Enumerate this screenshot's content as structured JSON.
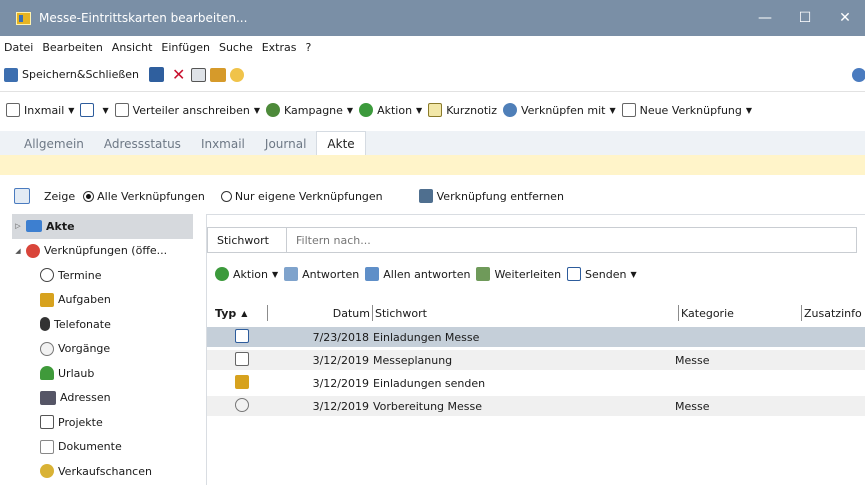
{
  "window": {
    "title": "Messe-Eintrittskarten bearbeiten...",
    "minimize": "—",
    "maximize": "☐",
    "close": "✕"
  },
  "menu": [
    "Datei",
    "Bearbeiten",
    "Ansicht",
    "Einfügen",
    "Suche",
    "Extras",
    "?"
  ],
  "toolbar1": {
    "save_close": "Speichern&Schließen"
  },
  "toolbar2": {
    "inxmail": "Inxmail",
    "verteiler": "Verteiler anschreiben",
    "kampagne": "Kampagne",
    "aktion": "Aktion",
    "kurznotiz": "Kurznotiz",
    "verknuepfen": "Verknüpfen mit",
    "neue_verknuepfung": "Neue Verknüpfung"
  },
  "tabs": [
    "Allgemein",
    "Adressstatus",
    "Inxmail",
    "Journal",
    "Akte"
  ],
  "filter": {
    "zeige": "Zeige",
    "alle": "Alle Verknüpfungen",
    "eigene": "Nur eigene Verknüpfungen",
    "entfernen": "Verknüpfung entfernen"
  },
  "sidebar": {
    "akte": "Akte",
    "verknuepfungen": "Verknüpfungen (öffe...",
    "items": [
      "Termine",
      "Aufgaben",
      "Telefonate",
      "Vorgänge",
      "Urlaub",
      "Adressen",
      "Projekte",
      "Dokumente",
      "Verkaufschancen"
    ]
  },
  "search": {
    "label": "Stichwort",
    "placeholder": "Filtern nach..."
  },
  "actions": {
    "aktion": "Aktion",
    "antworten": "Antworten",
    "allen": "Allen antworten",
    "weiterleiten": "Weiterleiten",
    "senden": "Senden"
  },
  "columns": {
    "typ": "Typ",
    "datum": "Datum",
    "stichwort": "Stichwort",
    "kategorie": "Kategorie",
    "zusatz": "Zusatzinfo"
  },
  "rows": [
    {
      "datum": "7/23/2018",
      "stichwort": "Einladungen Messe",
      "kategorie": ""
    },
    {
      "datum": "3/12/2019",
      "stichwort": "Messeplanung",
      "kategorie": "Messe"
    },
    {
      "datum": "3/12/2019",
      "stichwort": "Einladungen senden",
      "kategorie": ""
    },
    {
      "datum": "3/12/2019",
      "stichwort": "Vorbereitung Messe",
      "kategorie": "Messe"
    }
  ],
  "colors": {
    "titlebar": "#7a8fa6",
    "info_bar": "#fff4c9",
    "selected_row": "#c5cfd9",
    "tabs_bg": "#eef2f6"
  }
}
